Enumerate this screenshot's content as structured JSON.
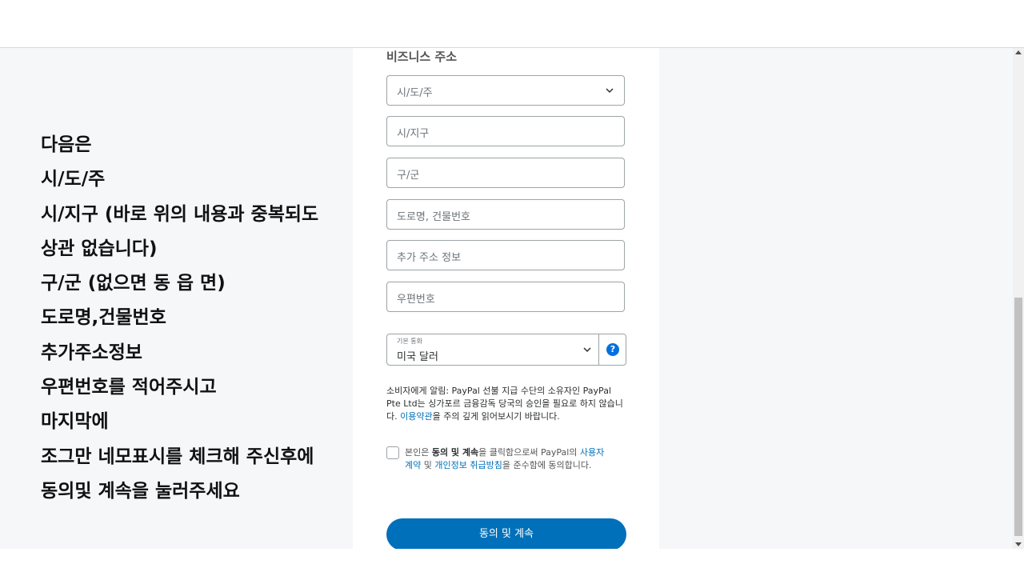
{
  "instructions": [
    "다음은",
    "시/도/주",
    "시/지구 (바로 위의 내용과 중복되도",
    "상관 없습니다)",
    "구/군 (없으면 동 읍 면)",
    "도로명,건물번호",
    "추가주소정보",
    "우편번호를 적어주시고",
    "마지막에",
    "조그만 네모표시를 체크해 주신후에",
    "동의및 계속을 눌러주세요"
  ],
  "form": {
    "section_title": "비즈니스 주소",
    "state_select": "시/도/주",
    "city_placeholder": "시/지구",
    "district_placeholder": "구/군",
    "street_placeholder": "도로명, 건물번호",
    "extra_placeholder": "추가 주소 정보",
    "postal_placeholder": "우편번호",
    "currency_label": "기본 통화",
    "currency_value": "미국 달러",
    "help_icon": "?",
    "notice_prefix": "소비자에게 알림: PayPal 선불 지급 수단의 소유자인 PayPal Pte Ltd는 싱가포르 금융감독 당국의 승인을 필요로 하지 않습니다. ",
    "notice_link": "이용약관",
    "notice_suffix": "을 주의 깊게 읽어보시기 바랍니다.",
    "agree_prefix": "본인은 ",
    "agree_bold": "동의 및 계속",
    "agree_mid": "을 클릭함으로써 PayPal의 ",
    "agree_link1": "사용자 계약",
    "agree_and": " 및 ",
    "agree_link2": "개인정보 취급방침",
    "agree_suffix": "을 준수함에 동의합니다.",
    "agree_checked": false,
    "continue_button": "동의 및 계속"
  },
  "colors": {
    "accent": "#0070ba",
    "help_icon": "#0070e0",
    "page_background": "#f6f7f9"
  }
}
